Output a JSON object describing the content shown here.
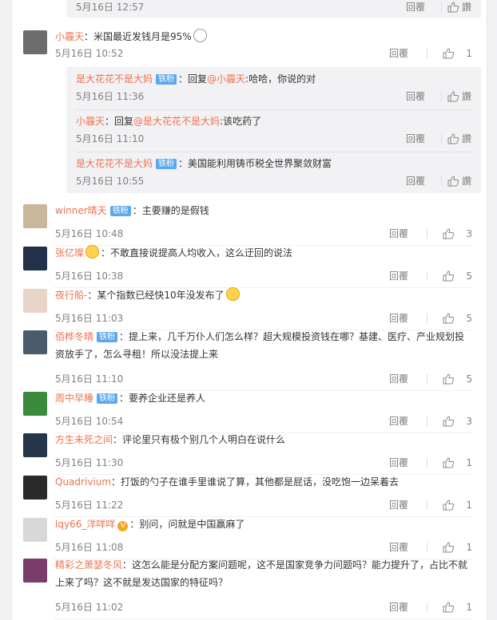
{
  "top_partial": {
    "time": "5月16日 12:57",
    "reply": "回覆",
    "like_label": "讚"
  },
  "comments": [
    {
      "id": "c1",
      "name": "小霾天",
      "badge": "",
      "text": "：米国最近发钱月是95%",
      "emoji": "glasses",
      "time": "5月16日 10:52",
      "reply": "回覆",
      "likes": "1",
      "avatar_color": "#6c6c6c"
    },
    {
      "id": "c2",
      "name": "winner晴天",
      "badge": "铁粉",
      "text": "：主要赚的是假钱",
      "time": "5月16日 10:48",
      "reply": "回覆",
      "likes": "3",
      "avatar_color": "#c9b79c"
    },
    {
      "id": "c3",
      "name": "张亿璨",
      "badge": "",
      "text": "：不敢直接说提高人均收入，这么迂回的说法",
      "time": "5月16日 10:38",
      "reply": "回覆",
      "likes": "5",
      "avatar_color": "#22304a"
    },
    {
      "id": "c4",
      "name": "夜行船-",
      "badge": "",
      "text": "：某个指数已经快10年没发布了",
      "time": "5月16日 11:03",
      "reply": "回覆",
      "likes": "5",
      "avatar_color": "#e9d4c8"
    },
    {
      "id": "c5",
      "name": "佰桦冬晴",
      "badge": "铁粉",
      "text": "：提上来，几千万仆人们怎么样？超大规模投资钱在哪？基建、医疗、产业规划投资放手了，怎么寻租！所以没法提上来",
      "time": "5月16日 11:10",
      "reply": "回覆",
      "likes": "5",
      "avatar_color": "#4a5b6c"
    },
    {
      "id": "c6",
      "name": "周中早睡",
      "badge": "铁粉",
      "text": "：要养企业还是养人",
      "time": "5月16日 10:54",
      "reply": "回覆",
      "likes": "3",
      "avatar_color": "#3c8a3c"
    },
    {
      "id": "c7",
      "name": "方生未死之间",
      "badge": "",
      "text": "：评论里只有极个别几个人明白在说什么",
      "time": "5月16日 11:30",
      "reply": "回覆",
      "likes": "1",
      "avatar_color": "#26364a"
    },
    {
      "id": "c8",
      "name": "Quadrivium",
      "badge": "",
      "text": "：打饭的勺子在谁手里谁说了算，其他都是屁话，没吃饱一边呆着去",
      "time": "5月16日 11:22",
      "reply": "回覆",
      "likes": "1",
      "avatar_color": "#2a2a2a"
    },
    {
      "id": "c9",
      "name": "lqy66_洋咩咩",
      "badge": "",
      "text": "：别问，问就是中国赢麻了",
      "time": "5月16日 11:08",
      "reply": "回覆",
      "likes": "1",
      "avatar_color": "#d8d8d8"
    },
    {
      "id": "c10",
      "name": "精彩之萧瑟冬风",
      "badge": "",
      "text": "：这怎么能是分配方案问题呢，这不是国家竞争力问题吗？能力提升了，占比不就上来了吗？这不就是发达国家的特征吗？",
      "time": "5月16日 11:02",
      "reply": "回覆",
      "likes": "1",
      "avatar_color": "#7b3b6b"
    }
  ],
  "replies": [
    {
      "name": "是大花花不是大妈",
      "badge": "铁粉",
      "prefix": "：回复",
      "mention": "@小霾天",
      "text": ":哈哈，你说的对",
      "time": "5月16日 11:36",
      "reply": "回覆",
      "like_label": "讚"
    },
    {
      "name": "小霾天",
      "badge": "",
      "prefix": "：回复",
      "mention": "@是大花花不是大妈",
      "text": ":该吃药了",
      "time": "5月16日 11:10",
      "reply": "回覆",
      "like_label": "讚"
    },
    {
      "name": "是大花花不是大妈",
      "badge": "铁粉",
      "prefix": "",
      "mention": "",
      "text": "：美国能利用铸币税全世界聚敛财富",
      "time": "5月16日 10:55",
      "reply": "回覆",
      "like_label": "讚"
    }
  ],
  "v_badge": "V",
  "colors": {
    "name": "#eb7350",
    "badge_bg": "#5aa9f0",
    "meta": "#808080",
    "page_bg": "#f2f2f5"
  },
  "icons": {
    "like": "thumb-up-icon"
  }
}
